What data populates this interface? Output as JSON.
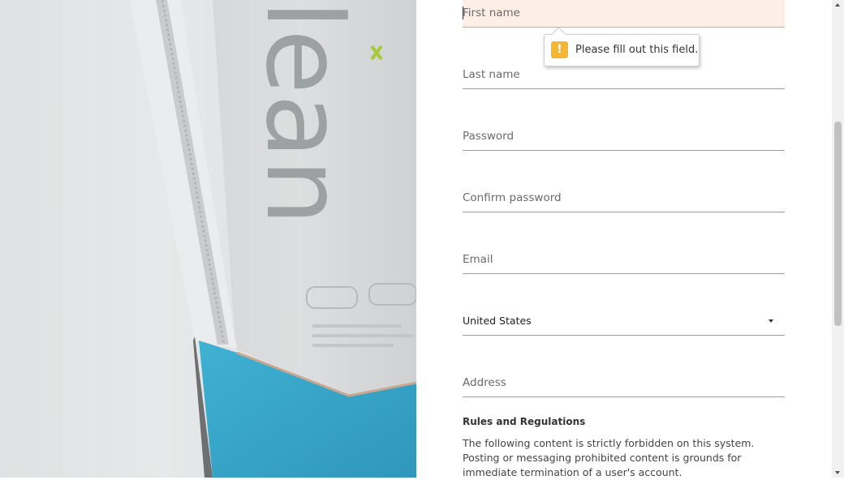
{
  "form": {
    "first_name_placeholder": "First name",
    "last_name_placeholder": "Last name",
    "password_placeholder": "Password",
    "confirm_password_placeholder": "Confirm password",
    "email_placeholder": "Email",
    "country_value": "United States",
    "address_placeholder": "Address"
  },
  "validation": {
    "message": "Please fill out this field.",
    "icon": "!"
  },
  "rules": {
    "title": "Rules and Regulations",
    "text": "The following content is strictly forbidden on this system. Posting or messaging prohibited content is grounds for immediate termination of a user's account."
  },
  "hero": {
    "package_text": "lean"
  },
  "colors": {
    "invalid_field_bg": "#fdeee6",
    "warning_icon": "#f5b731",
    "box_blue": "#3aa7c9"
  }
}
